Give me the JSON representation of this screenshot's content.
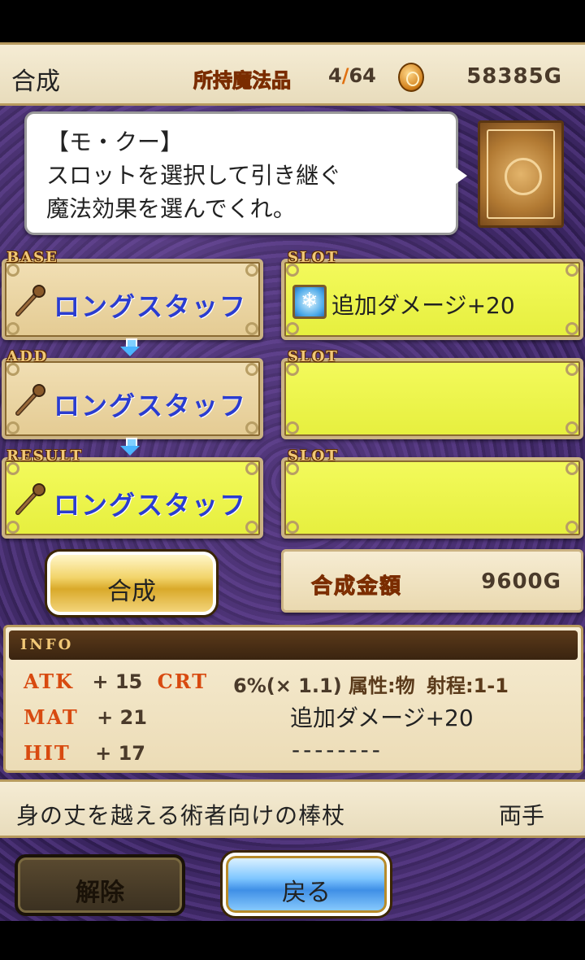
{
  "header": {
    "title": "合成",
    "owned_label": "所持魔法品",
    "owned_current": "4",
    "owned_sep": "/",
    "owned_max": "64",
    "gold": "58385G"
  },
  "dialog": {
    "speaker": "【モ・クー】",
    "line1": "スロットを選択して引き継ぐ",
    "line2": "魔法効果を選んでくれ。"
  },
  "rows": {
    "base": {
      "tag": "BASE",
      "item": "ロングスタッフ"
    },
    "add": {
      "tag": "ADD",
      "item": "ロングスタッフ"
    },
    "result": {
      "tag": "RESULT",
      "item": "ロングスタッフ"
    },
    "slot1": {
      "tag": "SLOT",
      "text": "追加ダメージ+20",
      "icon": "ice-crystal-icon"
    },
    "slot2": {
      "tag": "SLOT",
      "text": ""
    },
    "slot3": {
      "tag": "SLOT",
      "text": ""
    }
  },
  "synth_button": "合成",
  "cost": {
    "label": "合成金額",
    "value": "9600G"
  },
  "info": {
    "title": "INFO",
    "atk_key": "ATK",
    "atk_val": "+ 15",
    "crt_key": "CRT",
    "crt_val": "6%(× 1.1)",
    "attr": "属性:物",
    "range": "射程:1-1",
    "mat_key": "MAT",
    "mat_val": "+ 21",
    "effect1": "追加ダメージ+20",
    "hit_key": "HIT",
    "hit_val": "+ 17",
    "effect2": "--------"
  },
  "description": {
    "text": "身の丈を越える術者向けの棒杖",
    "hand": "両手"
  },
  "buttons": {
    "release": "解除",
    "back": "戻る"
  },
  "colors": {
    "accent_orange": "#e07010",
    "item_blue": "#2a3cd0",
    "slot_yellow": "#f3fa5c"
  }
}
